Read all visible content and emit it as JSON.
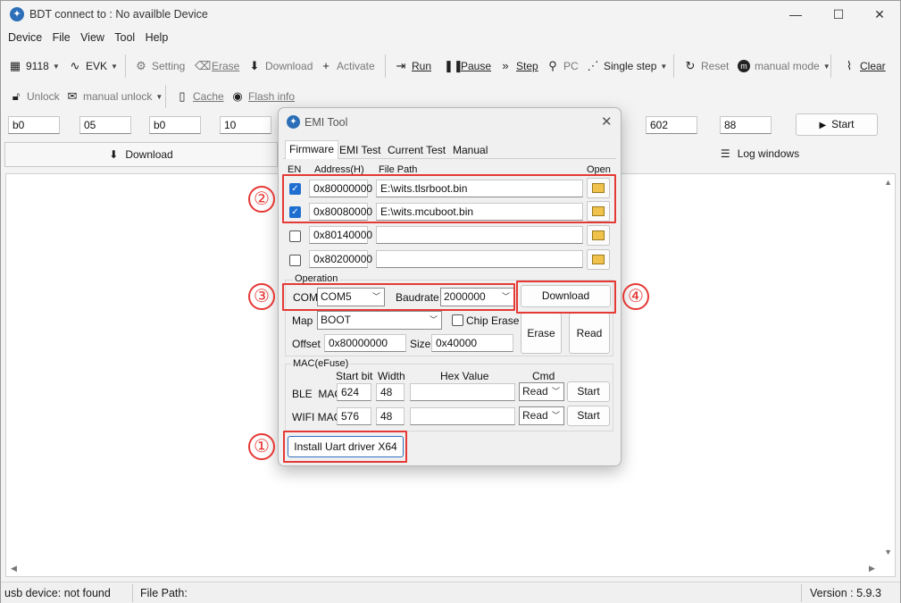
{
  "window": {
    "title": "BDT connect to : No availble Device"
  },
  "menu": [
    "Device",
    "File",
    "View",
    "Tool",
    "Help"
  ],
  "toolbar1": {
    "chip": "9118",
    "board": "EVK",
    "setting": "Setting",
    "erase": "Erase",
    "download": "Download",
    "activate": "Activate",
    "run": "Run",
    "pause": "Pause",
    "step": "Step",
    "pc": "PC",
    "single_step": "Single step",
    "reset": "Reset",
    "manual_mode": "manual mode",
    "clear": "Clear"
  },
  "toolbar2": {
    "unlock": "Unlock",
    "manual_unlock": "manual unlock",
    "cache": "Cache",
    "flash_info": "Flash info"
  },
  "fields": {
    "f1": "b0",
    "f2": "05",
    "f3": "b0",
    "f4": "10",
    "f5": "602",
    "f6": "88",
    "start": "Start"
  },
  "panes": {
    "download_tab": "Download",
    "log_tab": "Log windows"
  },
  "status": {
    "device": "usb device: not found",
    "file_path": "File Path:",
    "version": "Version : 5.9.3"
  },
  "dialog": {
    "title": "EMI Tool",
    "tabs": [
      "Firmware",
      "EMI Test",
      "Current Test",
      "Manual"
    ],
    "headers": {
      "en": "EN",
      "address": "Address(H)",
      "file_path": "File Path",
      "open": "Open"
    },
    "rows": [
      {
        "checked": true,
        "address": "0x80000000",
        "path": "E:\\wits.tlsrboot.bin"
      },
      {
        "checked": true,
        "address": "0x80080000",
        "path": "E:\\wits.mcuboot.bin"
      },
      {
        "checked": false,
        "address": "0x80140000",
        "path": ""
      },
      {
        "checked": false,
        "address": "0x80200000",
        "path": ""
      }
    ],
    "operation": {
      "group": "Operation",
      "com_label": "COM",
      "com_value": "COM5",
      "baud_label": "Baudrate",
      "baud_value": "2000000",
      "download": "Download",
      "map_label": "Map",
      "map_value": "BOOT",
      "chip_erase": "Chip Erase",
      "offset_label": "Offset",
      "offset_value": "0x80000000",
      "size_label": "Size",
      "size_value": "0x40000",
      "erase": "Erase",
      "read": "Read"
    },
    "mac": {
      "group": "MAC(eFuse)",
      "start_bit": "Start bit",
      "width": "Width",
      "hex_value": "Hex Value",
      "cmd": "Cmd",
      "ble_label": "BLE  MAC",
      "ble_start": "624",
      "ble_width": "48",
      "ble_cmd": "Read",
      "ble_btn": "Start",
      "wifi_label": "WIFI MAC",
      "wifi_start": "576",
      "wifi_width": "48",
      "wifi_cmd": "Read",
      "wifi_btn": "Start"
    },
    "install_driver": "Install Uart driver X64"
  },
  "callouts": [
    "①",
    "②",
    "③",
    "④"
  ],
  "colors": {
    "callout": "#e53935",
    "check": "#1f6fd1"
  }
}
